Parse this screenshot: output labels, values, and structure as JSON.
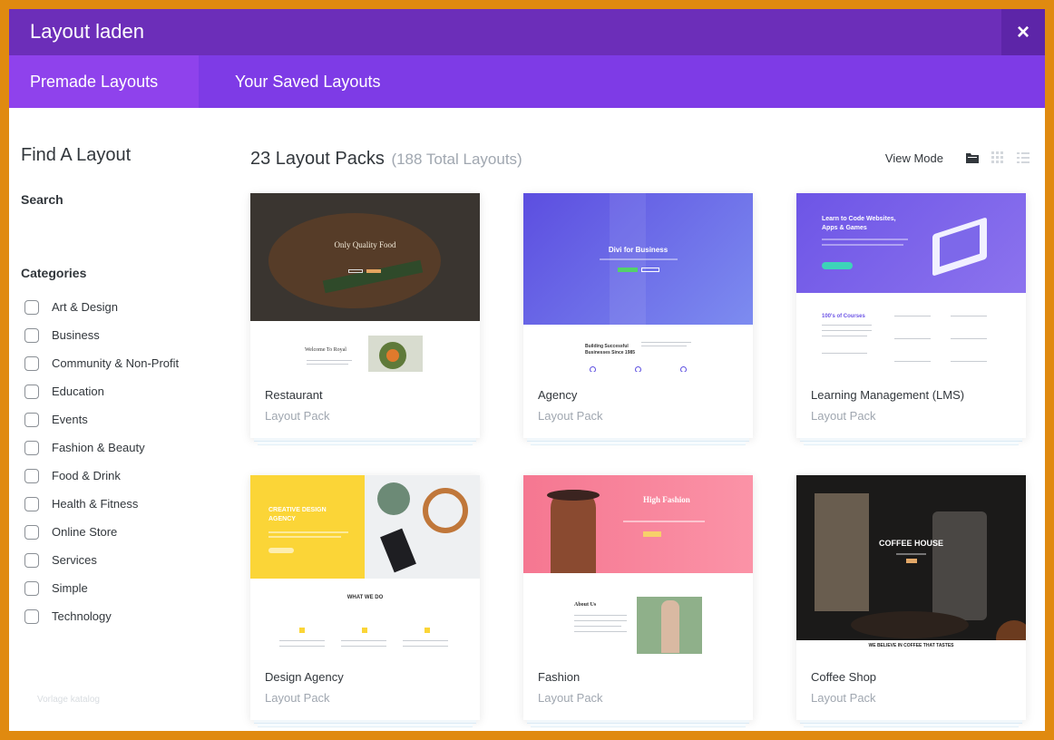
{
  "modal": {
    "title": "Layout laden",
    "close_glyph": "×"
  },
  "tabs": [
    {
      "label": "Premade Layouts",
      "active": true
    },
    {
      "label": "Your Saved Layouts",
      "active": false
    }
  ],
  "sidebar": {
    "heading": "Find A Layout",
    "search_label": "Search",
    "search_value": "",
    "categories_label": "Categories",
    "categories": [
      "Art & Design",
      "Business",
      "Community & Non-Profit",
      "Education",
      "Events",
      "Fashion & Beauty",
      "Food & Drink",
      "Health & Fitness",
      "Online Store",
      "Services",
      "Simple",
      "Technology"
    ],
    "footnote": "Vorlage katalog"
  },
  "content": {
    "packs_title": "23 Layout Packs",
    "total_layouts": "(188 Total Layouts)",
    "view_mode_label": "View Mode",
    "view_icons": [
      "folder-view-icon",
      "grid-view-icon",
      "list-view-icon"
    ]
  },
  "cards": [
    {
      "name": "Restaurant",
      "sub": "Layout Pack",
      "thumb": {
        "headline": "Only Quality Food",
        "section": "Welcome To Royal"
      }
    },
    {
      "name": "Agency",
      "sub": "Layout Pack",
      "thumb": {
        "headline": "Divi for Business",
        "section": "Building Successful Businesses Since 1985"
      }
    },
    {
      "name": "Learning Management (LMS)",
      "sub": "Layout Pack",
      "thumb": {
        "headline": "Learn to Code Websites, Apps & Games",
        "section": "100's of Courses"
      }
    },
    {
      "name": "Design Agency",
      "sub": "Layout Pack",
      "thumb": {
        "headline": "CREATIVE DESIGN AGENCY",
        "section": "WHAT WE DO"
      }
    },
    {
      "name": "Fashion",
      "sub": "Layout Pack",
      "thumb": {
        "headline": "High Fashion",
        "section": "About Us"
      }
    },
    {
      "name": "Coffee Shop",
      "sub": "Layout Pack",
      "thumb": {
        "headline": "COFFEE HOUSE",
        "section": "WE BELIEVE IN COFFEE THAT TASTES"
      }
    }
  ],
  "colors": {
    "frame": "#e08a10",
    "titlebar": "#6c2eb9",
    "tabbar": "#7e3be6",
    "tab_active": "#8f42ec",
    "muted_text": "#a0a7b0"
  }
}
